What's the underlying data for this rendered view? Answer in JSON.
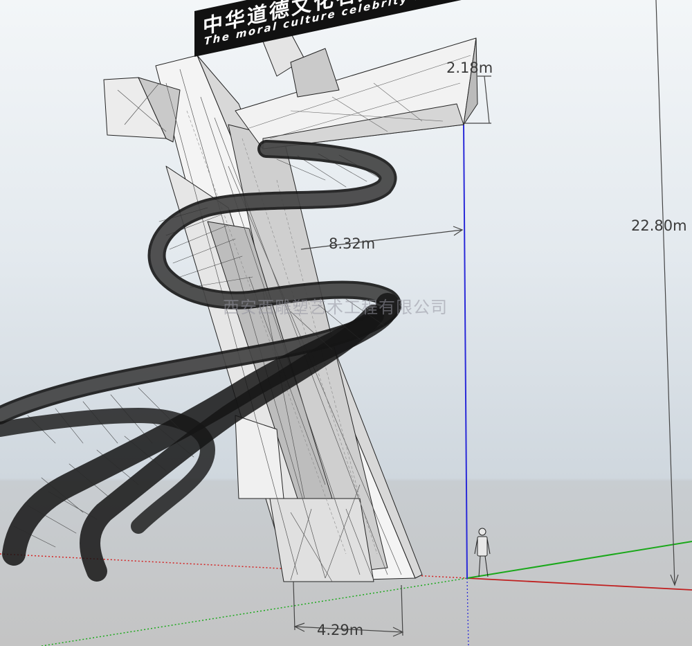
{
  "sign": {
    "chinese_title": "中华道德文化名人主题公园",
    "english_title": "The moral culture celebrity theme park"
  },
  "dimensions": {
    "total_height": "22.80m",
    "top_offset": "2.18m",
    "arm_reach": "8.32m",
    "base_width": "4.29m"
  },
  "watermark": "西安西雕塑艺术工程有限公司",
  "colors": {
    "blue_axis": "#2a2ad8",
    "green_axis": "#1aa81a",
    "red_axis": "#d42020",
    "dimension_line": "#444444",
    "ribbon": "#151515"
  },
  "icons": {
    "person": "scale-figure-icon"
  }
}
